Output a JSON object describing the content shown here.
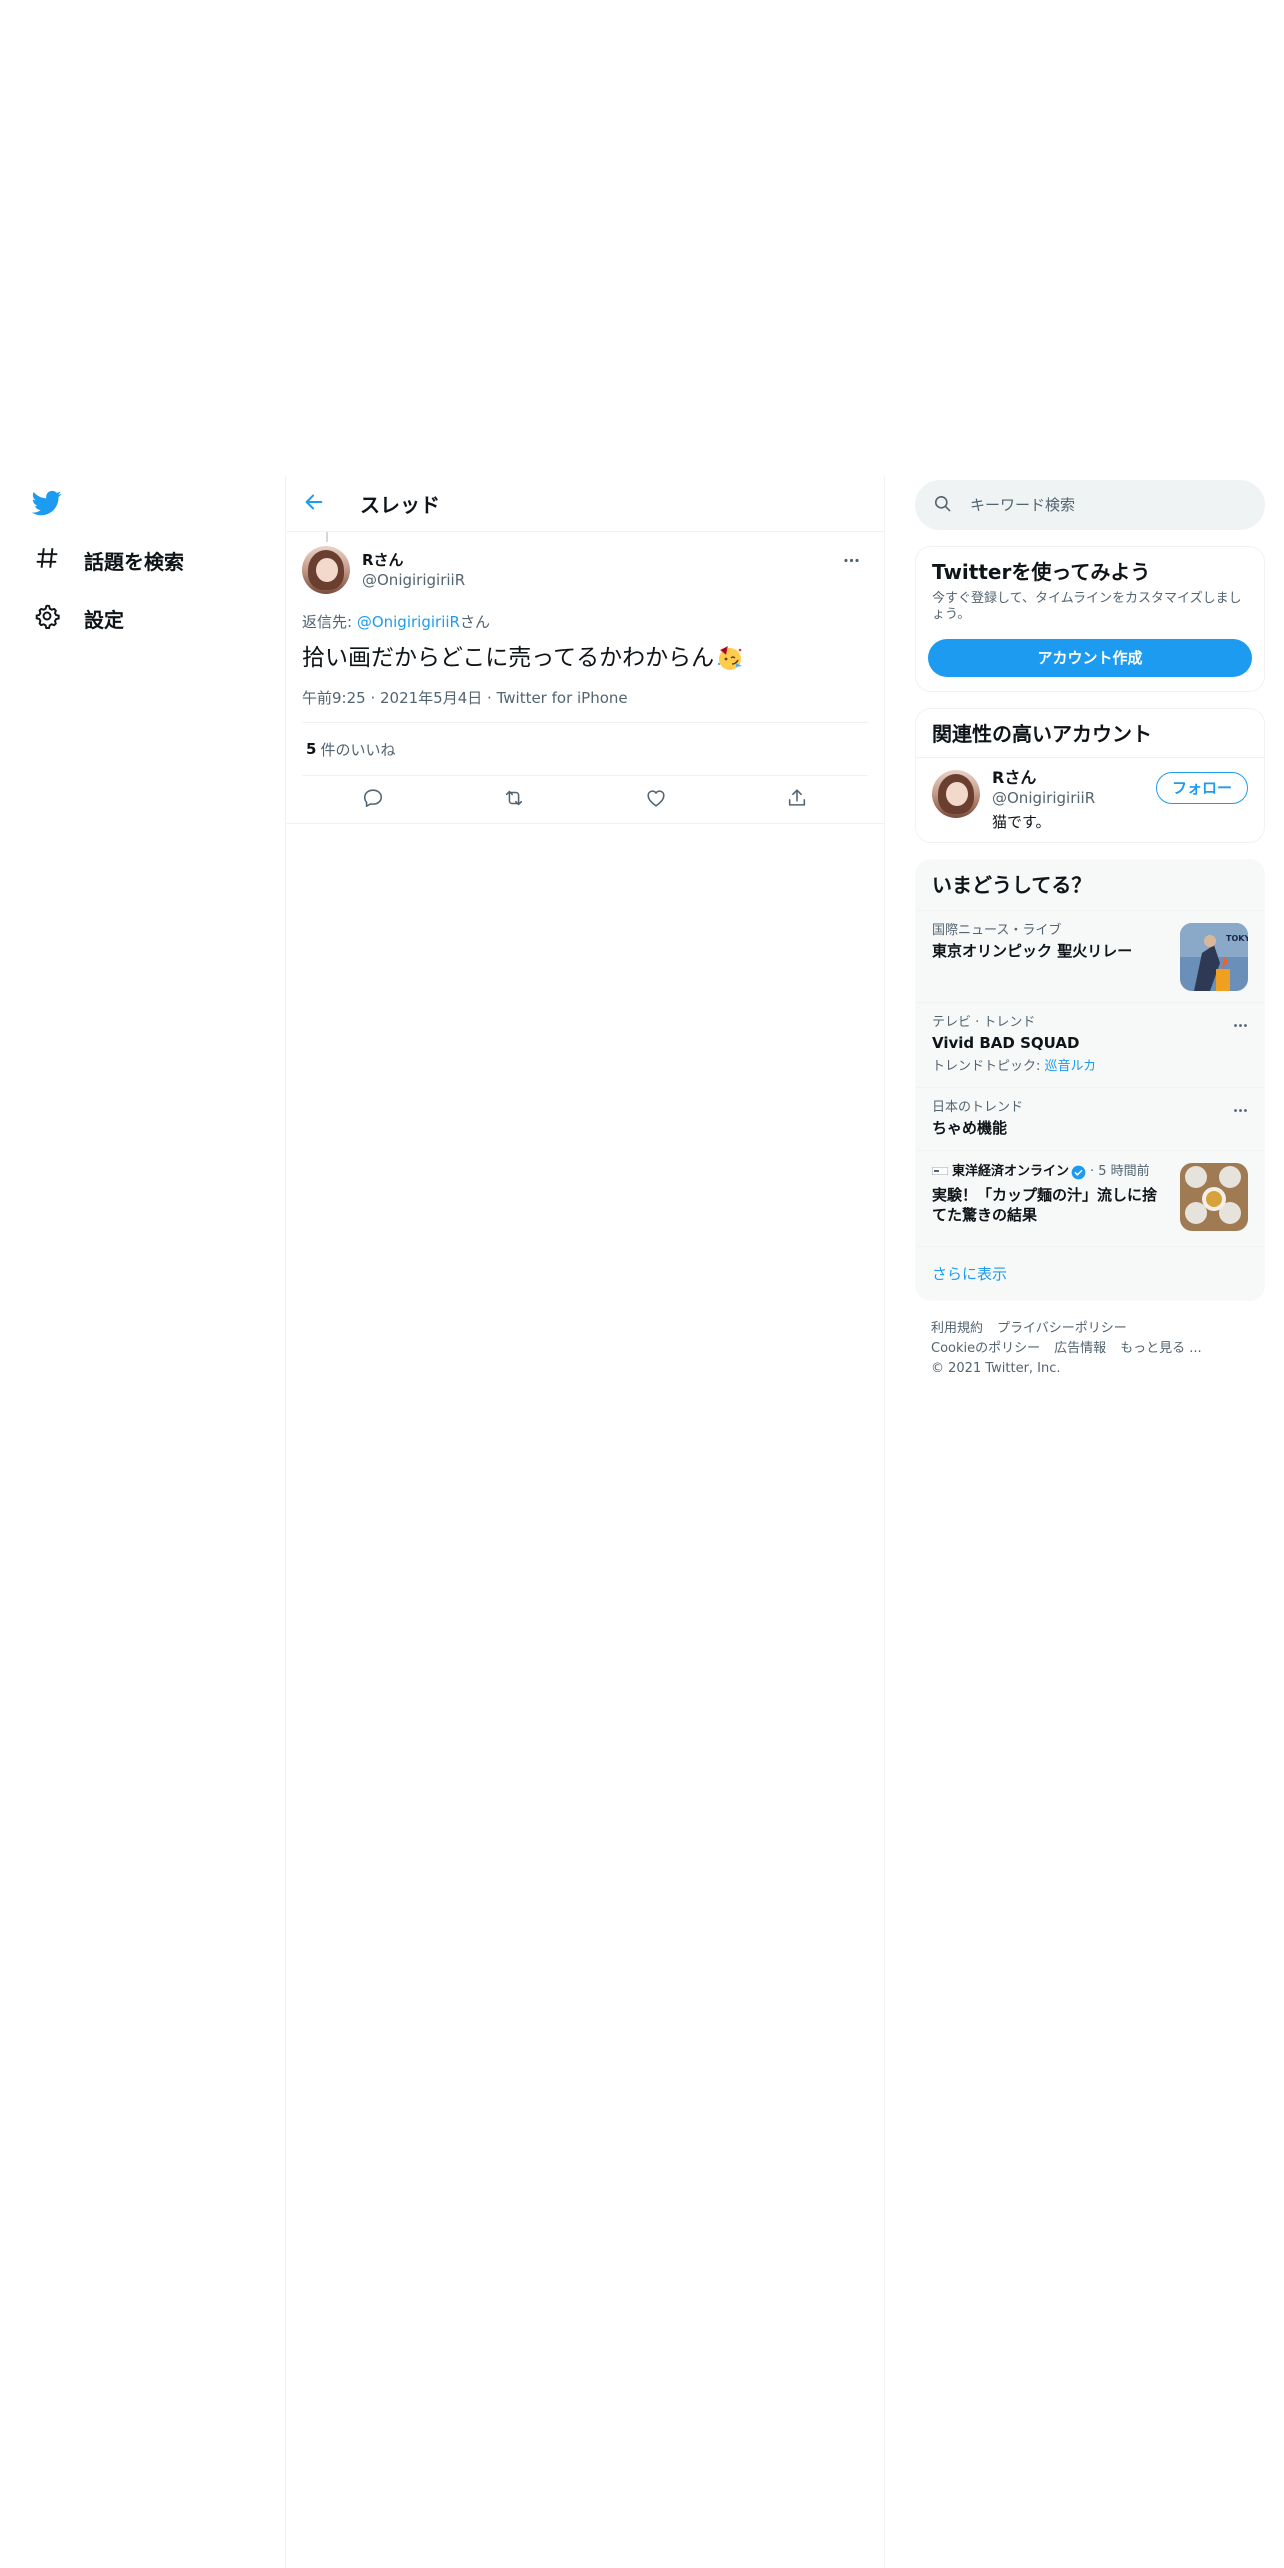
{
  "nav": {
    "items": [
      {
        "label": "話題を検索"
      },
      {
        "label": "設定"
      }
    ]
  },
  "main": {
    "title": "スレッド",
    "tweet": {
      "display_name": "Rさん",
      "handle": "@OnigirigiriiR",
      "reply_prefix": "返信先: ",
      "reply_handle": "@OnigirigiriiR",
      "reply_suffix": "さん",
      "text": "拾い画だからどこに売ってるかわからん",
      "time": "午前9:25",
      "date": "2021年5月4日",
      "source": "Twitter for iPhone",
      "like_count": "5",
      "like_label": "件のいいね"
    }
  },
  "sidebar": {
    "search_placeholder": "キーワード検索",
    "signup": {
      "title": "Twitterを使ってみよう",
      "desc": "今すぐ登録して、タイムラインをカスタマイズしましょう。",
      "button": "アカウント作成"
    },
    "related": {
      "title": "関連性の高いアカウント",
      "user": {
        "display_name": "Rさん",
        "handle": "@OnigirigiriiR",
        "bio": "猫です。",
        "follow": "フォロー"
      }
    },
    "trends": {
      "title": "いまどうしてる？",
      "items": [
        {
          "context": "国際ニュース・ライブ",
          "name": "東京オリンピック 聖火リレー"
        },
        {
          "context": "テレビ · トレンド",
          "name": "Vivid BAD SQUAD",
          "sub_prefix": "トレンドトピック: ",
          "sub_link": "巡音ルカ"
        },
        {
          "context": "日本のトレンド",
          "name": "ちゃめ機能"
        }
      ],
      "news": {
        "source": "東洋経済オンライン",
        "time": "· 5 時間前",
        "title": "実験！「カップ麺の汁」流しに捨てた驚きの結果"
      },
      "thumb_text": "TOKYO",
      "show_more": "さらに表示"
    },
    "footer": {
      "links": [
        "利用規約",
        "プライバシーポリシー",
        "Cookieのポリシー",
        "広告情報",
        "もっと見る ..."
      ],
      "copyright": "© 2021 Twitter, Inc."
    }
  },
  "colors": {
    "accent": "#1d9bf0",
    "text": "#0f1419",
    "muted": "#536471",
    "border": "#eff3f4"
  }
}
